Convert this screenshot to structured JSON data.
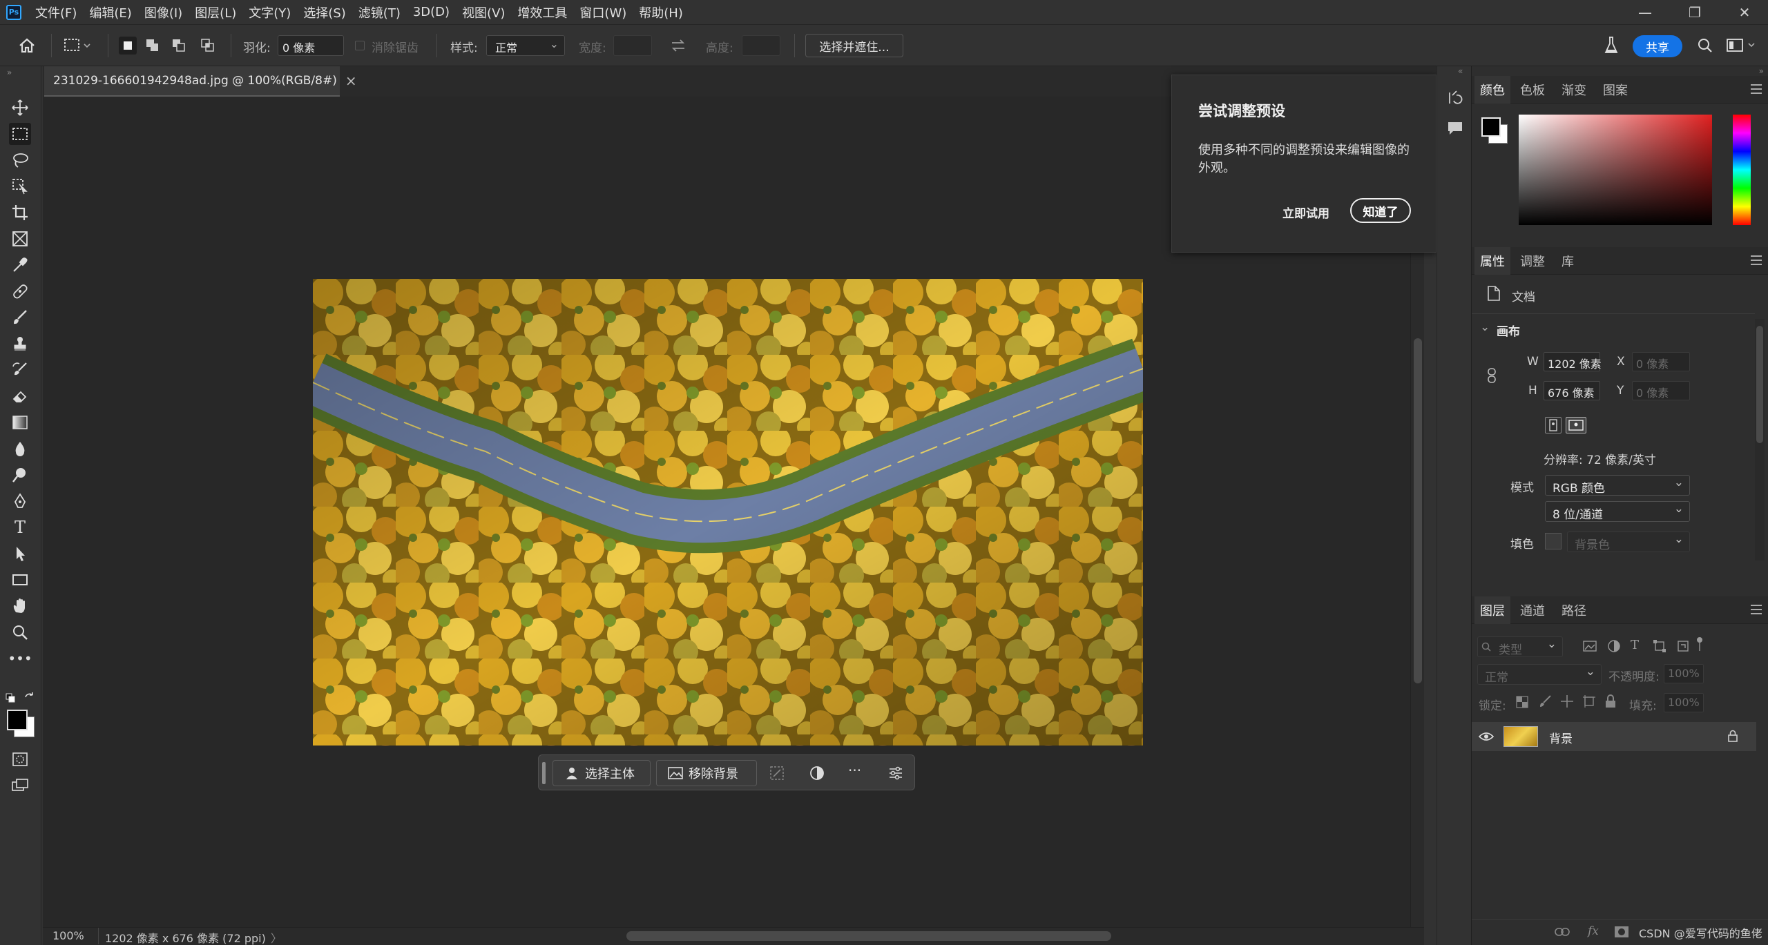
{
  "app": {
    "logo": "Ps"
  },
  "menu": [
    "文件(F)",
    "编辑(E)",
    "图像(I)",
    "图层(L)",
    "文字(Y)",
    "选择(S)",
    "滤镜(T)",
    "3D(D)",
    "视图(V)",
    "增效工具",
    "窗口(W)",
    "帮助(H)"
  ],
  "window_controls": {
    "minimize": "—",
    "restore": "❐",
    "close": "✕"
  },
  "options_bar": {
    "feather_label": "羽化:",
    "feather_value": "0 像素",
    "antialias_label": "消除锯齿",
    "style_label": "样式:",
    "style_value": "正常",
    "width_label": "宽度:",
    "height_label": "高度:",
    "select_mask_button": "选择并遮住...",
    "share_button": "共享"
  },
  "document": {
    "tab_title": "231029-166601942948ad.jpg @ 100%(RGB/8#)",
    "tab_close": "×"
  },
  "status_bar": {
    "zoom": "100%",
    "info": "1202 像素 x 676 像素 (72 ppi)",
    "arrow": "〉"
  },
  "contextual_taskbar": {
    "select_subject": "选择主体",
    "remove_background": "移除背景",
    "more": "···"
  },
  "tip_popup": {
    "title": "尝试调整预设",
    "body": "使用多种不同的调整预设来编辑图像的外观。",
    "try_now": "立即试用",
    "got_it": "知道了"
  },
  "color_panel": {
    "tabs": [
      "颜色",
      "色板",
      "渐变",
      "图案"
    ],
    "hue_color": "#e02020"
  },
  "properties_panel": {
    "tabs": [
      "属性",
      "调整",
      "库"
    ],
    "doc_label": "文档",
    "canvas_section": "画布",
    "w_label": "W",
    "w_value": "1202 像素",
    "h_label": "H",
    "h_value": "676 像素",
    "x_label": "X",
    "x_value": "0 像素",
    "y_label": "Y",
    "y_value": "0 像素",
    "resolution": "分辨率: 72 像素/英寸",
    "mode_label": "模式",
    "mode_value": "RGB 颜色",
    "depth_value": "8 位/通道",
    "fill_label": "填色",
    "fill_value": "背景色"
  },
  "layers_panel": {
    "tabs": [
      "图层",
      "通道",
      "路径"
    ],
    "filter_placeholder": "类型",
    "blend_mode": "正常",
    "opacity_label": "不透明度:",
    "opacity_value": "100%",
    "lock_label": "锁定:",
    "fill_label": "填充:",
    "fill_value": "100%",
    "layers": [
      {
        "name": "背景"
      }
    ],
    "footer_fx": "fx"
  },
  "watermark": "CSDN @爱写代码的鱼佬"
}
